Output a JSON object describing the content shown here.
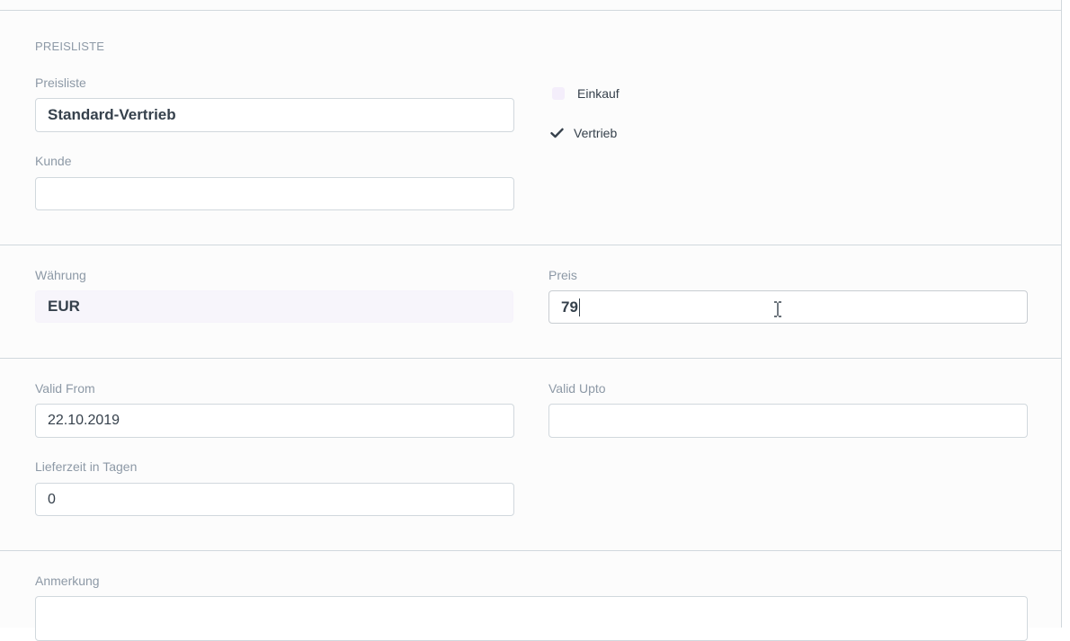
{
  "section": {
    "title": "PREISLISTE"
  },
  "price_list": {
    "label": "Preisliste",
    "value": "Standard-Vertrieb"
  },
  "customer": {
    "label": "Kunde",
    "value": ""
  },
  "flags": {
    "buying": {
      "label": "Einkauf",
      "checked": false
    },
    "selling": {
      "label": "Vertrieb",
      "checked": true
    }
  },
  "currency": {
    "label": "Währung",
    "value": "EUR"
  },
  "price": {
    "label": "Preis",
    "value": "79"
  },
  "valid_from": {
    "label": "Valid From",
    "value": "22.10.2019"
  },
  "valid_upto": {
    "label": "Valid Upto",
    "value": ""
  },
  "lead_time": {
    "label": "Lieferzeit in Tagen",
    "value": "0"
  },
  "note": {
    "label": "Anmerkung",
    "value": ""
  },
  "icons": {
    "check": "check-icon",
    "cursor": "text-cursor-icon"
  }
}
